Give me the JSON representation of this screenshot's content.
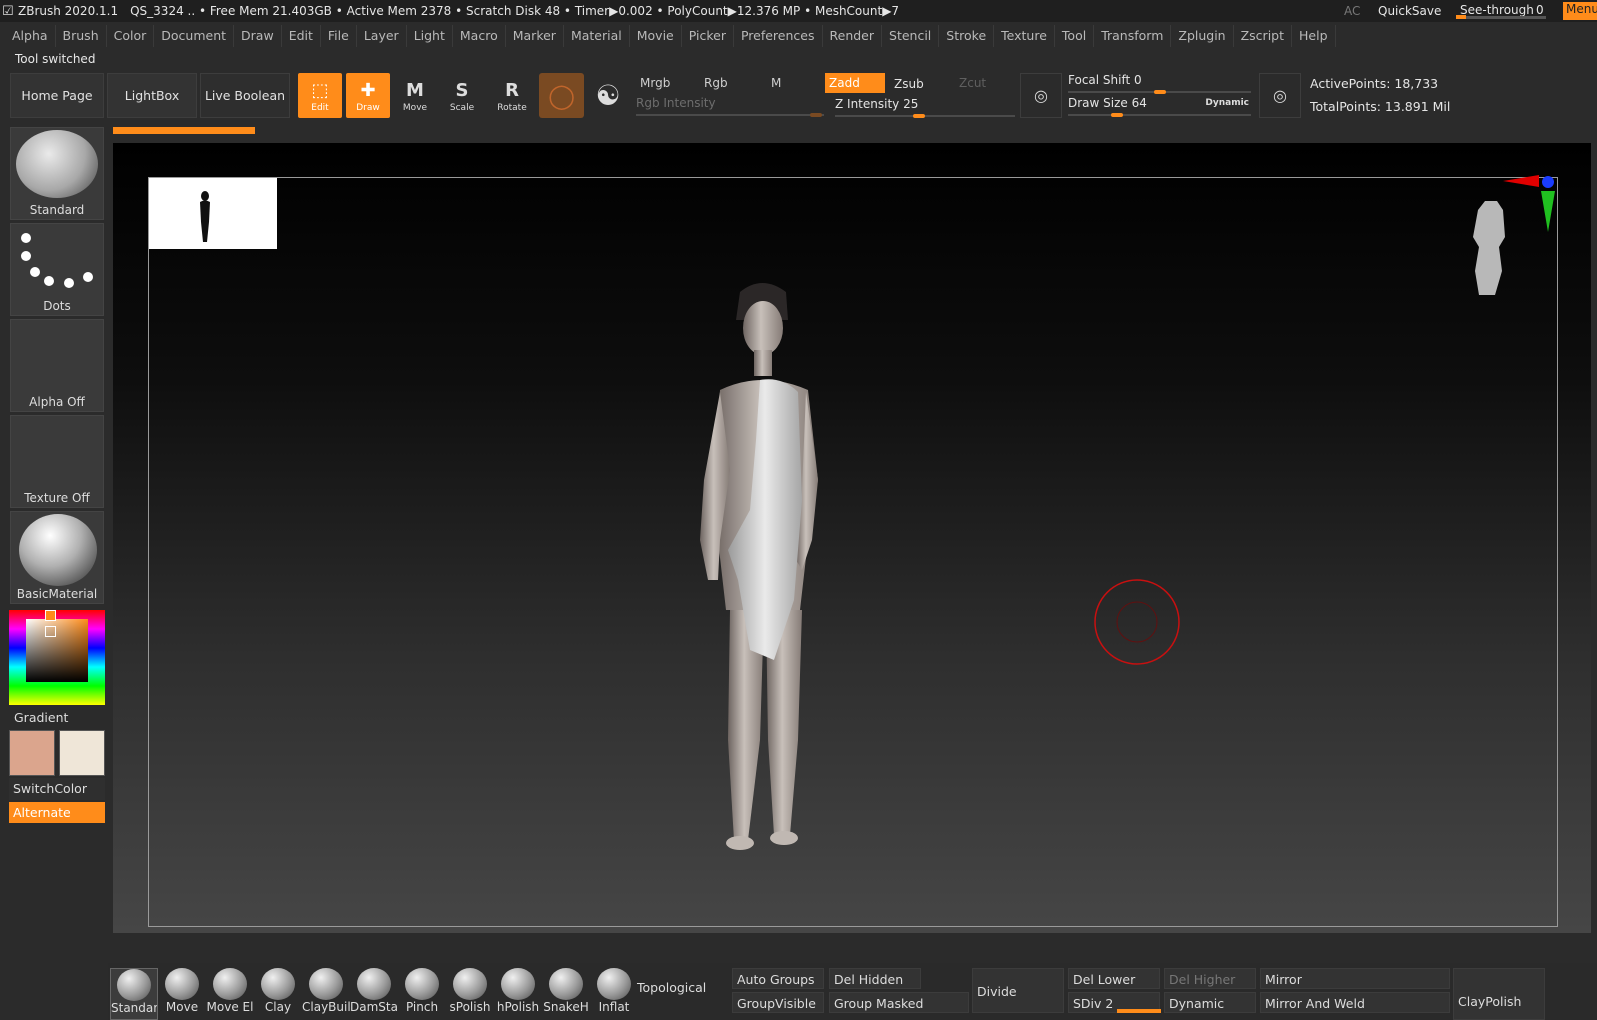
{
  "titlebar": {
    "app": "ZBrush 2020.1.1",
    "stats": "QS_3324   .. • Free Mem 21.403GB • Active Mem 2378 • Scratch Disk 48 •  Timer▶0.002 • PolyCount▶12.376 MP  • MeshCount▶7",
    "ac": "AC",
    "quicksave": "QuickSave",
    "seethrough": "See-through",
    "seethrough_value": "0",
    "seethrough_level": 0,
    "menus": "Menus"
  },
  "menubar": [
    "Alpha",
    "Brush",
    "Color",
    "Document",
    "Draw",
    "Edit",
    "File",
    "Layer",
    "Light",
    "Macro",
    "Marker",
    "Material",
    "Movie",
    "Picker",
    "Preferences",
    "Render",
    "Stencil",
    "Stroke",
    "Texture",
    "Tool",
    "Transform",
    "Zplugin",
    "Zscript",
    "Help"
  ],
  "status": "Tool switched",
  "shelf": {
    "home_page": "Home Page",
    "lightbox": "LightBox",
    "live_boolean": "Live Boolean",
    "edit": "Edit",
    "draw": "Draw",
    "move": "Move",
    "scale": "Scale",
    "rotate": "Rotate",
    "mrgb": "Mrgb",
    "rgb": "Rgb",
    "m": "M",
    "rgb_intensity": "Rgb Intensity",
    "zadd": "Zadd",
    "zsub": "Zsub",
    "zcut": "Zcut",
    "z_intensity_label": "Z Intensity",
    "z_intensity": "25",
    "focal_shift_label": "Focal Shift",
    "focal_shift": "0",
    "draw_size_label": "Draw Size",
    "draw_size": "64",
    "dynamic": "Dynamic",
    "active_points": "ActivePoints: 18,733",
    "total_points": "TotalPoints: 13.891 Mil"
  },
  "left": {
    "brush": "Standard",
    "stroke": "Dots",
    "alpha": "Alpha Off",
    "texture": "Texture Off",
    "material": "BasicMaterial",
    "gradient": "Gradient",
    "switchcolor": "SwitchColor",
    "alternate": "Alternate",
    "main_color": "#dba58d",
    "secondary_color": "#efe6d8"
  },
  "bottom": {
    "brushes": [
      "Standar",
      "Move",
      "Move El",
      "Clay",
      "ClayBuil",
      "DamSta",
      "Pinch",
      "sPolish",
      "hPolish",
      "SnakeH",
      "Inflat"
    ],
    "topological": "Topological",
    "auto_groups": "Auto Groups",
    "groupvisible": "GroupVisible",
    "del_hidden": "Del Hidden",
    "group_masked": "Group Masked",
    "divide": "Divide",
    "del_lower": "Del Lower",
    "del_higher": "Del Higher",
    "sdiv_label": "SDiv",
    "sdiv": "2",
    "dynamic": "Dynamic",
    "mirror": "Mirror",
    "mirror_and_weld": "Mirror And Weld",
    "claypolish": "ClayPolish"
  }
}
